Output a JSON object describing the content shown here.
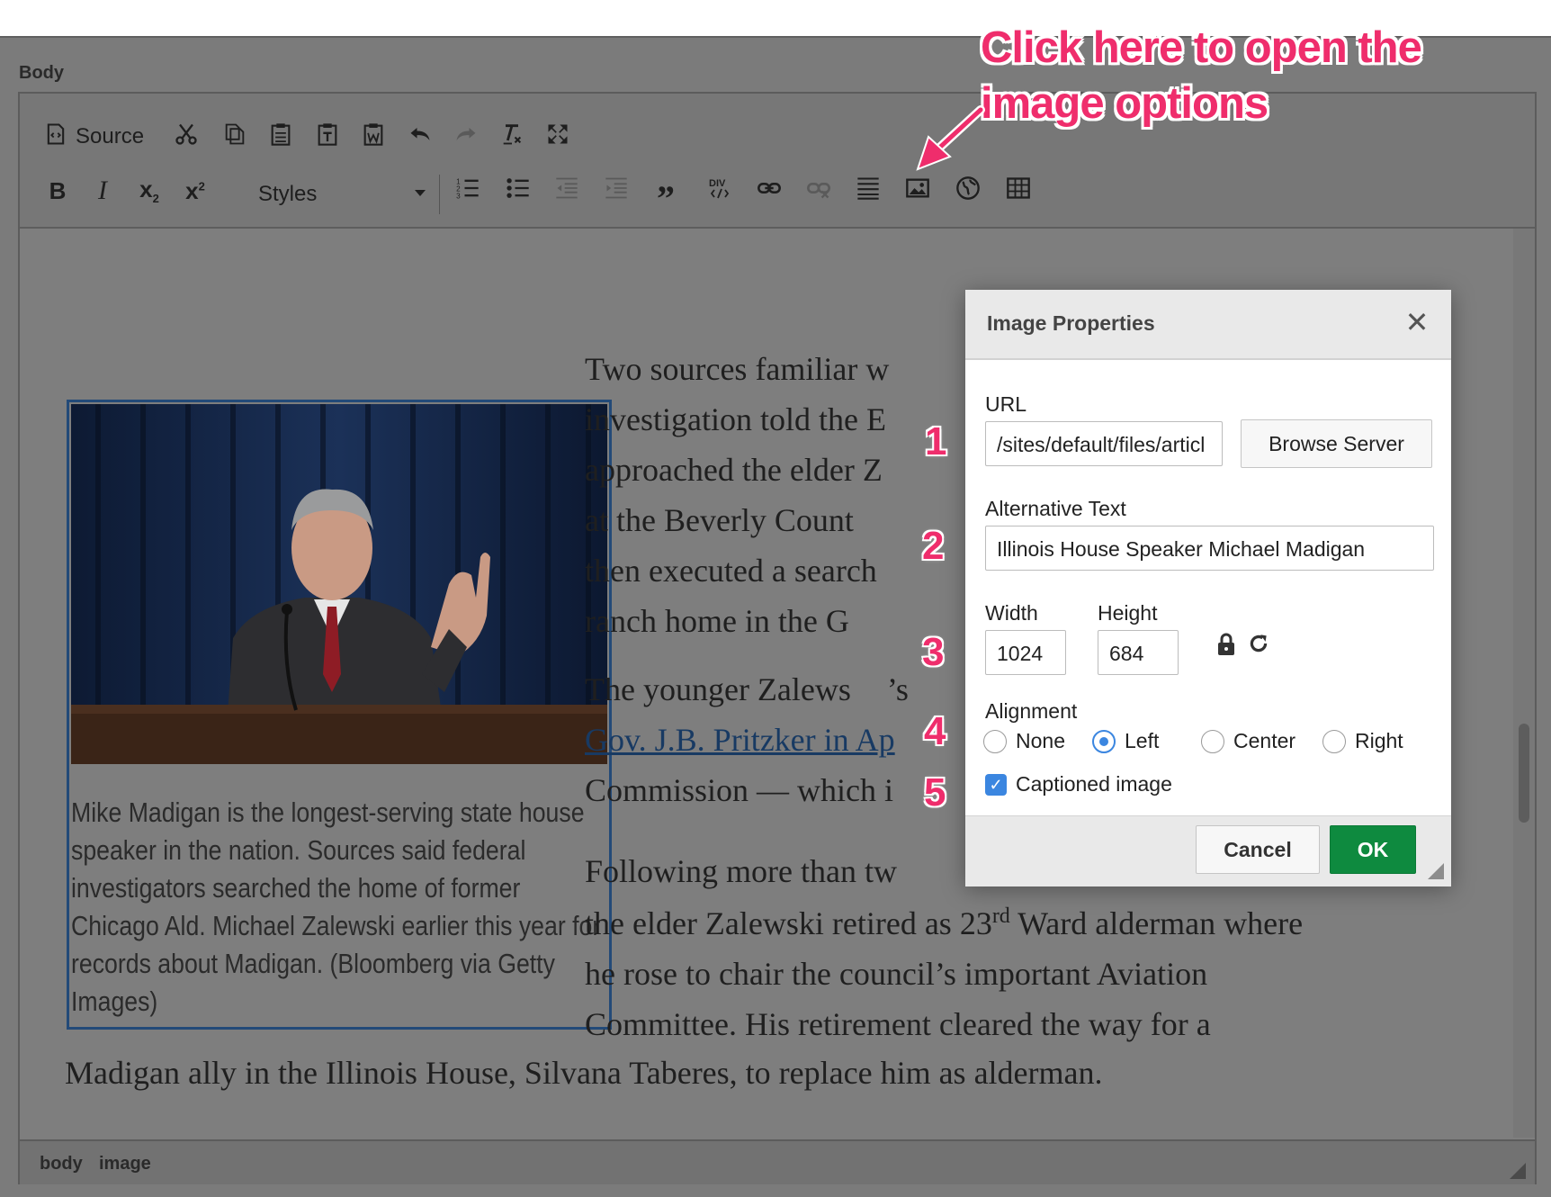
{
  "field_label": "Body",
  "toolbar": {
    "source_label": "Source",
    "styles_label": "Styles",
    "buttons_row1": [
      "source-icon",
      "cut-icon",
      "copy-icon",
      "paste-icon",
      "paste-text-icon",
      "paste-word-icon",
      "undo-icon",
      "redo-icon",
      "remove-format-icon",
      "maximize-icon"
    ],
    "buttons_row2": [
      "bold-icon",
      "italic-icon",
      "subscript-icon",
      "superscript-icon",
      "numbered-list-icon",
      "bulleted-list-icon",
      "outdent-icon",
      "indent-icon",
      "blockquote-icon",
      "div-icon",
      "link-icon",
      "unlink-icon",
      "horizontal-line-icon",
      "image-icon",
      "globe-icon",
      "table-icon"
    ]
  },
  "content": {
    "caption": "Mike Madigan is the longest-serving state house speaker in the nation. Sources said federal investigators searched the home of former Chicago Ald. Michael Zalewski earlier this year for records about Madigan. (Bloomberg via Getty Images)",
    "p1_lines": [
      "Two sources familiar w",
      "investigation told the E",
      "approached the elder Z",
      "at the Beverly Count",
      "then executed a search",
      "ranch home in the G"
    ],
    "p2_line1": "The younger Zalews",
    "p2_line1_tail": "’s",
    "p2_link": "Gov. J.B. Pritzker in Ap",
    "p2_line3": "Commission — which i",
    "p3_line1": "Following more than tw",
    "p3_line2_a": "the elder Zalewski retired as 23",
    "p3_line2_sup": "rd",
    "p3_line2_b": " Ward alderman where",
    "p3_line3": "he rose to chair the council’s important Aviation",
    "p3_line4": "Committee. His retirement cleared the way for a",
    "p3_line5": "Madigan ally in the Illinois House, Silvana Taberes, to replace him as alderman."
  },
  "statusbar": {
    "path": [
      "body",
      "image"
    ]
  },
  "dialog": {
    "title": "Image Properties",
    "url_label": "URL",
    "url_value": "/sites/default/files/articl",
    "browse_label": "Browse Server",
    "alt_label": "Alternative Text",
    "alt_value": "Illinois House Speaker Michael Madigan",
    "width_label": "Width",
    "width_value": "1024",
    "height_label": "Height",
    "height_value": "684",
    "alignment_label": "Alignment",
    "alignment_options": [
      "None",
      "Left",
      "Center",
      "Right"
    ],
    "alignment_selected": "Left",
    "captioned_label": "Captioned image",
    "captioned_checked": true,
    "cancel_label": "Cancel",
    "ok_label": "OK"
  },
  "annotations": {
    "callout_line1": "Click here to open the",
    "callout_line2": "image options",
    "numbers": [
      "1",
      "2",
      "3",
      "4",
      "5"
    ],
    "color": "#ef2d6c"
  },
  "colors": {
    "ok_button": "#0e8a3f",
    "accent": "#3b86e0",
    "link": "#183a63"
  }
}
